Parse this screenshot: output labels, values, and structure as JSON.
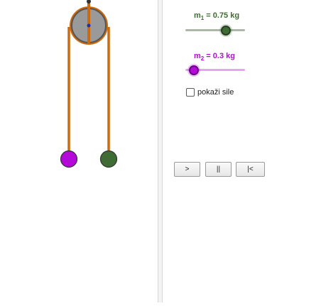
{
  "controls": {
    "m1": {
      "label_prefix": "m",
      "label_sub": "1",
      "label_suffix": " = 0.75 kg",
      "value": 0.75,
      "position_fraction": 0.68,
      "color": "#3f6b34"
    },
    "m2": {
      "label_prefix": "m",
      "label_sub": "2",
      "label_suffix": " = 0.3 kg",
      "value": 0.3,
      "position_fraction": 0.14,
      "color": "#b30ad9"
    },
    "show_forces": {
      "label": "pokaži sile",
      "checked": false
    },
    "buttons": {
      "play": ">",
      "pause": "||",
      "reset": "|<"
    }
  },
  "colors": {
    "rope": "#cc6a0f",
    "pulley": "#999999",
    "mass1": "#3f6b34",
    "mass2": "#b30ad9"
  }
}
